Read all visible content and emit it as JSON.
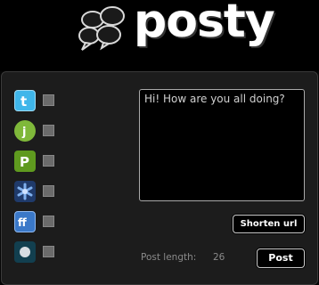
{
  "app": {
    "logo_text": "posty"
  },
  "services": [
    {
      "name": "twitter",
      "icon": "twitter-icon",
      "color": "#35b3e8",
      "checked": false
    },
    {
      "name": "jaiku",
      "icon": "jaiku-icon",
      "color": "#7fb83a",
      "checked": false
    },
    {
      "name": "plurk",
      "icon": "plurk-icon",
      "color": "#5f9a1f",
      "checked": false
    },
    {
      "name": "identica",
      "icon": "snowflake-icon",
      "color": "#2e4f8c",
      "checked": false
    },
    {
      "name": "friendfeed",
      "icon": "friendfeed-icon",
      "color": "#3a78c8",
      "checked": false
    },
    {
      "name": "other",
      "icon": "circle-icon",
      "color": "#1b5a6e",
      "checked": false
    }
  ],
  "composer": {
    "text": "Hi! How are you all doing?",
    "post_length_label": "Post length:",
    "post_length_value": "26"
  },
  "buttons": {
    "shorten_url": "Shorten url",
    "post": "Post"
  }
}
